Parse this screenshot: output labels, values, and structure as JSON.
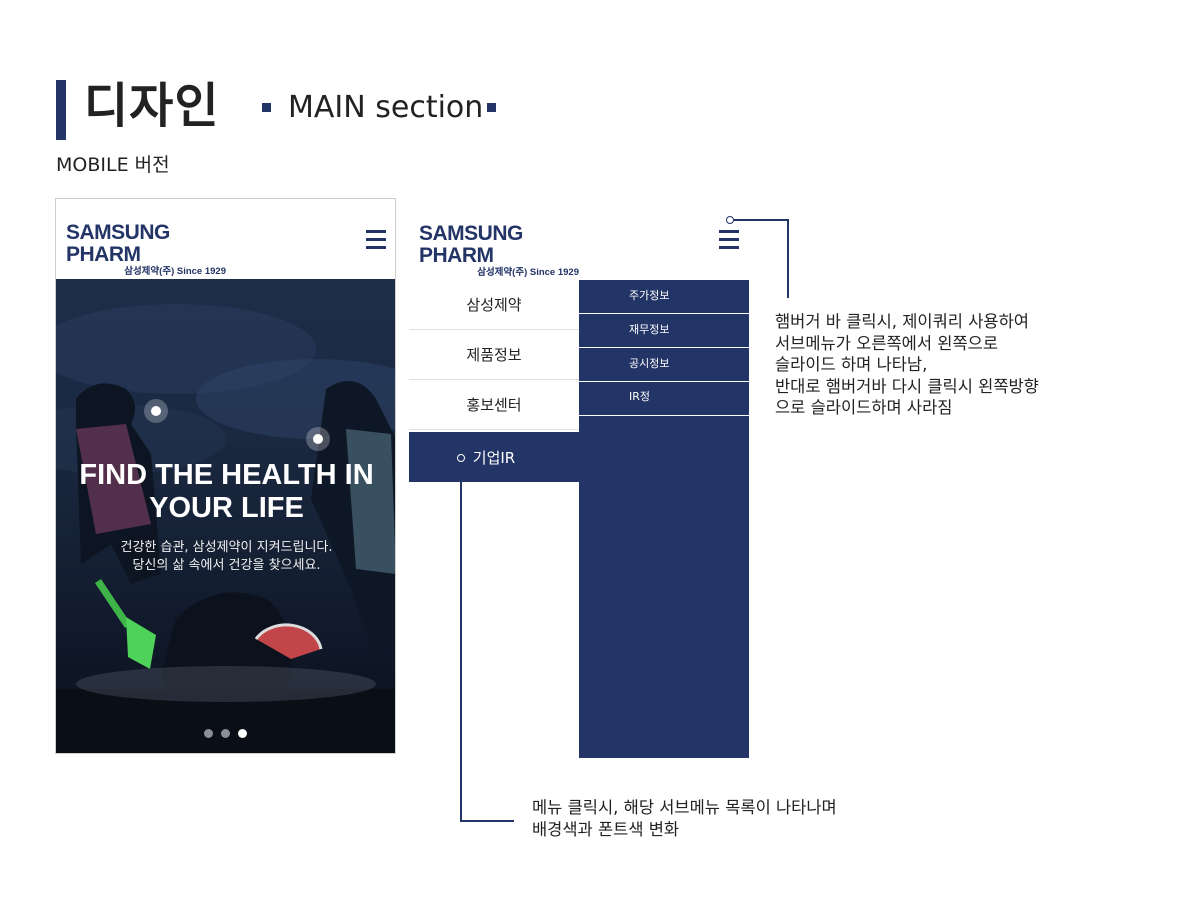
{
  "header": {
    "title": "디자인",
    "section": "MAIN section",
    "subtitle": "MOBILE 버전"
  },
  "logo": {
    "main": "SAMSUNG PHARM",
    "sub": "삼성제약(주) Since 1929"
  },
  "hero": {
    "title_line1": "FIND THE HEALTH IN",
    "title_line2": "YOUR LIFE",
    "sub_line1": "건강한 습관, 삼성제약이 지켜드립니다.",
    "sub_line2": "당신의 삶 속에서 건강을 찾으세요.",
    "slide_count": 3,
    "active_slide": 3
  },
  "menu": {
    "items": [
      "삼성제약",
      "제품정보",
      "홍보센터",
      "기업IR"
    ],
    "active_index": 3
  },
  "submenu": {
    "items": [
      "주가정보",
      "재무정보",
      "공시정보",
      "IR정"
    ]
  },
  "annotations": {
    "hamburger_note": "햄버거 바 클릭시, 제이쿼리 사용하여\n서브메뉴가 오른쪽에서 왼쪽으로\n슬라이드 하며 나타남,\n반대로 햄버거바 다시 클릭시 왼쪽방향\n으로 슬라이드하며 사라짐",
    "menu_note": "메뉴 클릭시, 해당 서브메뉴 목록이 나타나며\n배경색과 폰트색 변화"
  },
  "colors": {
    "brand_navy": "#233466",
    "divider": "#e1e1e1"
  }
}
